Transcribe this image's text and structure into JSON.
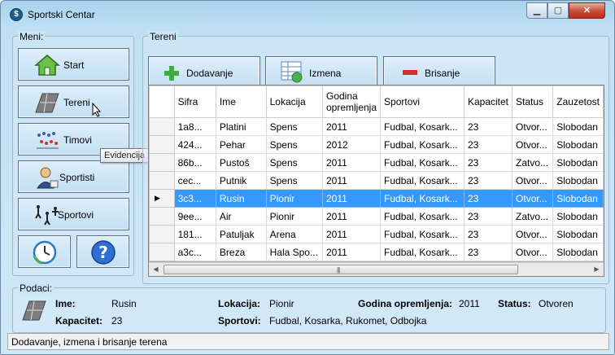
{
  "window": {
    "title": "Sportski Centar"
  },
  "menu": {
    "label": "Meni:",
    "items": [
      {
        "label": "Start",
        "icon": "house-icon"
      },
      {
        "label": "Tereni",
        "icon": "court-icon"
      },
      {
        "label": "Timovi",
        "icon": "team-icon"
      },
      {
        "label": "Sportisti",
        "icon": "athlete-icon"
      },
      {
        "label": "Sportovi",
        "icon": "sports-icon"
      }
    ],
    "bottom_buttons": [
      "clock-refresh-icon",
      "help-icon"
    ]
  },
  "tooltip": "Evidencija terena",
  "tereni": {
    "label": "Tereni",
    "toolbar": [
      {
        "label": "Dodavanje",
        "icon": "plus-icon"
      },
      {
        "label": "Izmena",
        "icon": "edit-table-icon"
      },
      {
        "label": "Brisanje",
        "icon": "minus-icon"
      }
    ],
    "columns": [
      "Sifra",
      "Ime",
      "Lokacija",
      "Godina opremljenja",
      "Sportovi",
      "Kapacitet",
      "Status",
      "Zauzetost"
    ],
    "rows": [
      [
        "1a8...",
        "Platini",
        "Spens",
        "2011",
        "Fudbal, Kosark...",
        "23",
        "Otvor...",
        "Slobodan"
      ],
      [
        "424...",
        "Pehar",
        "Spens",
        "2012",
        "Fudbal, Kosark...",
        "23",
        "Otvor...",
        "Slobodan"
      ],
      [
        "86b...",
        "Pustoš",
        "Spens",
        "2011",
        "Fudbal, Kosark...",
        "23",
        "Zatvo...",
        "Slobodan"
      ],
      [
        "cec...",
        "Putnik",
        "Spens",
        "2011",
        "Fudbal, Kosark...",
        "23",
        "Otvor...",
        "Slobodan"
      ],
      [
        "3c3...",
        "Rusin",
        "Pionir",
        "2011",
        "Fudbal, Kosark...",
        "23",
        "Otvor...",
        "Slobodan"
      ],
      [
        "9ee...",
        "Air",
        "Pionir",
        "2011",
        "Fudbal, Kosark...",
        "23",
        "Zatvo...",
        "Slobodan"
      ],
      [
        "181...",
        "Patuljak",
        "Arena",
        "2011",
        "Fudbal, Kosark...",
        "23",
        "Otvor...",
        "Slobodan"
      ],
      [
        "a3c...",
        "Breza",
        "Hala Spo...",
        "2011",
        "Fudbal, Kosark...",
        "23",
        "Otvor...",
        "Slobodan"
      ]
    ],
    "selected_row": 4
  },
  "podaci": {
    "label": "Podaci:",
    "ime_label": "Ime:",
    "ime": "Rusin",
    "lokacija_label": "Lokacija:",
    "lokacija": "Pionir",
    "godina_label": "Godina opremljenja:",
    "godina": "2011",
    "status_label": "Status:",
    "status": "Otvoren",
    "kapacitet_label": "Kapacitet:",
    "kapacitet": "23",
    "sportovi_label": "Sportovi:",
    "sportovi": "Fudbal, Kosarka, Rukomet, Odbojka"
  },
  "statusbar": {
    "text": "Dodavanje, izmena i brisanje terena"
  }
}
